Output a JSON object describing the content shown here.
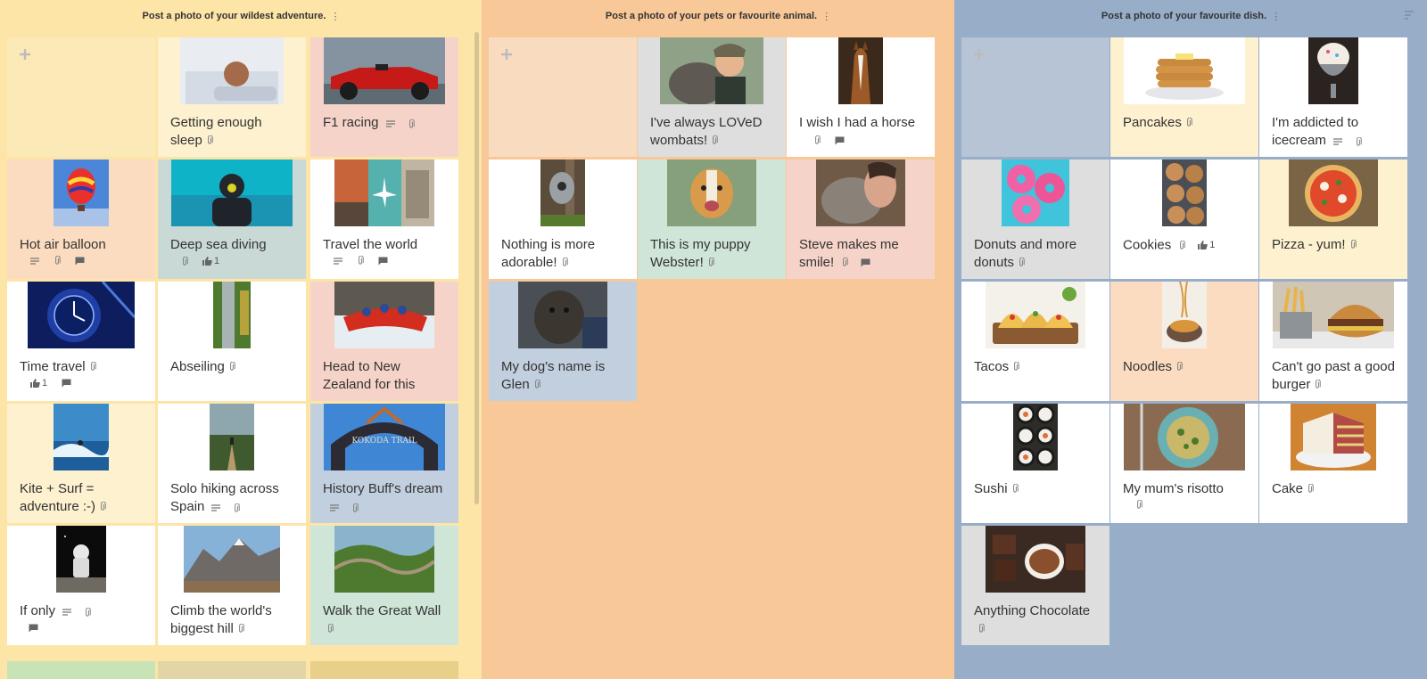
{
  "columns": [
    {
      "title": "Post a photo of your wildest adventure.",
      "cards": [
        {
          "title": "Getting enough sleep"
        },
        {
          "title": "F1 racing"
        },
        {
          "title": "Hot air balloon"
        },
        {
          "title": "Deep sea diving",
          "likes": "1"
        },
        {
          "title": "Travel the world"
        },
        {
          "title": "Time travel",
          "likes": "1"
        },
        {
          "title": "Abseiling"
        },
        {
          "title": "Head to New Zealand for this"
        },
        {
          "title": "Kite + Surf = adventure :-)"
        },
        {
          "title": "Solo hiking across Spain"
        },
        {
          "title": "History Buff's dream"
        },
        {
          "title": "If only"
        },
        {
          "title": "Climb the world's biggest hill"
        },
        {
          "title": "Walk the Great Wall"
        }
      ]
    },
    {
      "title": "Post a photo of your pets or favourite animal.",
      "cards": [
        {
          "title": "I've always LOVeD wombats!"
        },
        {
          "title": "I wish I had a horse"
        },
        {
          "title": "Nothing is more adorable!"
        },
        {
          "title": "This is my puppy Webster!"
        },
        {
          "title": "Steve makes me smile!"
        },
        {
          "title": "My dog's name is Glen"
        }
      ]
    },
    {
      "title": "Post a photo of your favourite dish.",
      "cards": [
        {
          "title": "Pancakes"
        },
        {
          "title": "I'm addicted to icecream"
        },
        {
          "title": "Donuts and more donuts"
        },
        {
          "title": "Cookies",
          "likes": "1"
        },
        {
          "title": "Pizza - yum!"
        },
        {
          "title": "Tacos"
        },
        {
          "title": "Noodles"
        },
        {
          "title": "Can't go past a good burger"
        },
        {
          "title": "Sushi"
        },
        {
          "title": "My mum's risotto"
        },
        {
          "title": "Cake"
        },
        {
          "title": "Anything Chocolate"
        }
      ]
    }
  ]
}
